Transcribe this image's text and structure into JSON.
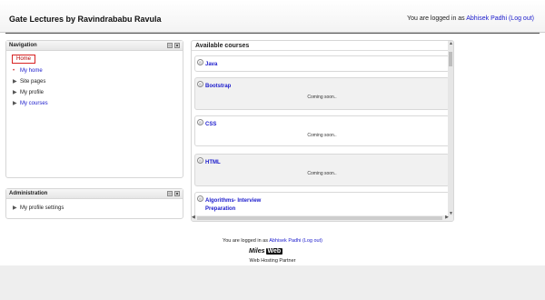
{
  "header": {
    "site_title": "Gate Lectures by Ravindrababu Ravula",
    "login_prefix": "You are logged in as ",
    "user_name": "Abhisek Padhi",
    "logout_label": "(Log out)"
  },
  "navigation": {
    "title": "Navigation",
    "home_label": "Home",
    "items": [
      {
        "label": "My home"
      },
      {
        "label": "Site pages"
      },
      {
        "label": "My profile"
      },
      {
        "label": "My courses"
      }
    ]
  },
  "administration": {
    "title": "Administration",
    "items": [
      {
        "label": "My profile settings"
      }
    ]
  },
  "main": {
    "title": "Available courses",
    "courses": [
      {
        "name": "Java",
        "summary": ""
      },
      {
        "name": "Bootstrap",
        "summary": "Coming soon.."
      },
      {
        "name": "CSS",
        "summary": "Coming soon.."
      },
      {
        "name": "HTML",
        "summary": "Coming soon.."
      },
      {
        "name": "Algorithms- Interview Preparation",
        "summary": ""
      }
    ]
  },
  "footer": {
    "login_prefix": "You are logged in as ",
    "user_name": "Abhisek Padhi",
    "logout_label": "(Log out)",
    "logo_part1": "Miles",
    "logo_part2": "Web",
    "partner_text": "Web Hosting Partner"
  },
  "colors": {
    "link": "#1a1acc",
    "home_border": "#d82222"
  }
}
